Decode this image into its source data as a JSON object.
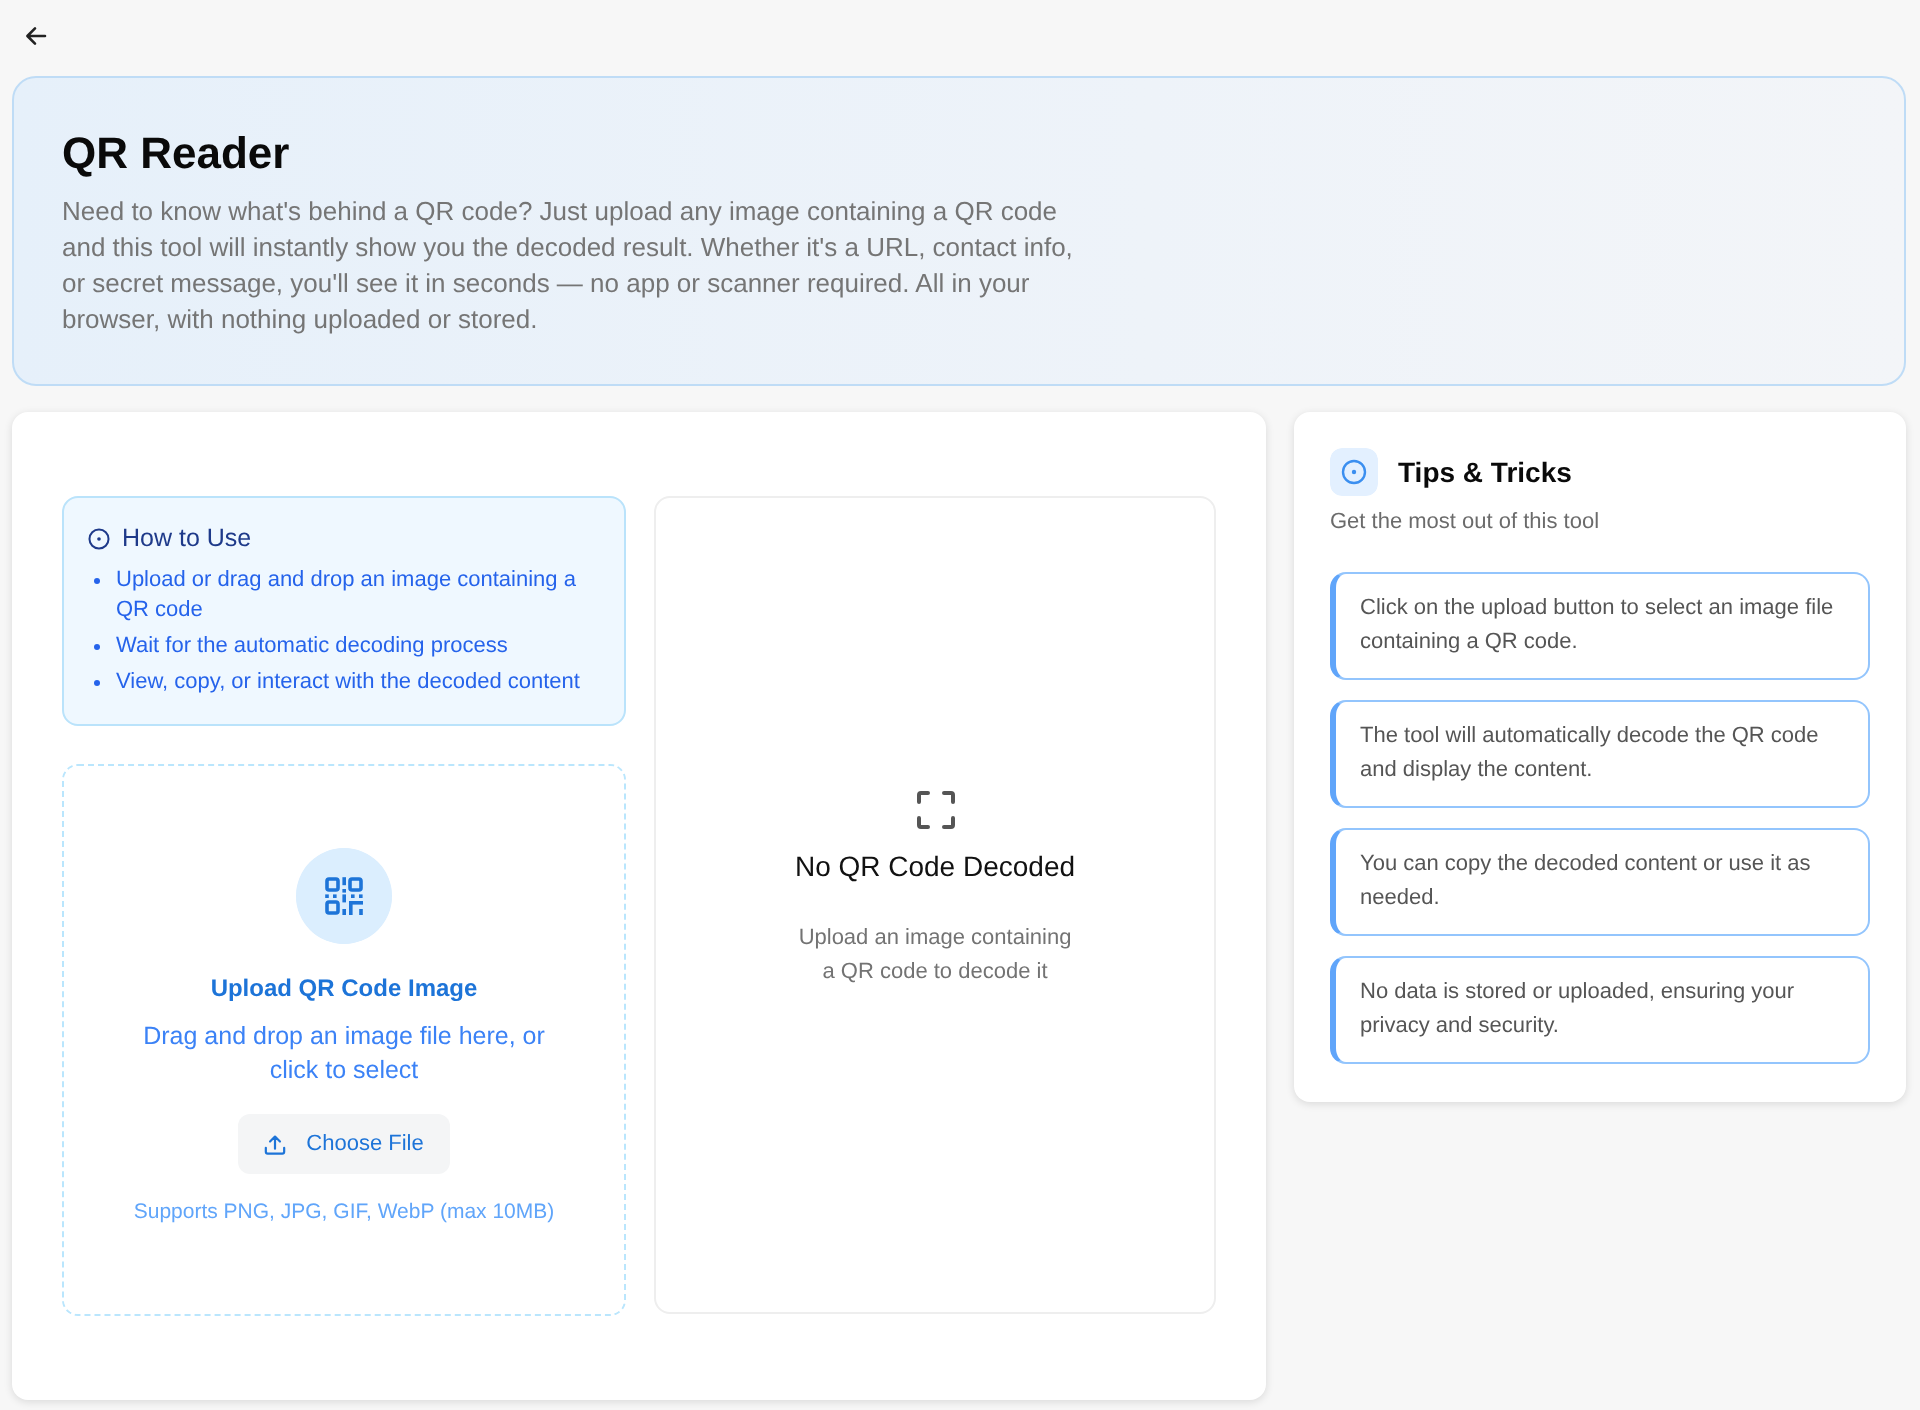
{
  "header": {
    "title": "QR Reader",
    "description": "Need to know what's behind a QR code? Just upload any image containing a QR code and this tool will instantly show you the decoded result. Whether it's a URL, contact info, or secret message, you'll see it in seconds — no app or scanner required. All in your browser, with nothing uploaded or stored."
  },
  "how_to_use": {
    "title": "How to Use",
    "steps": [
      "Upload or drag and drop an image containing a QR code",
      "Wait for the automatic decoding process",
      "View, copy, or interact with the decoded content"
    ]
  },
  "upload": {
    "title": "Upload QR Code Image",
    "description": "Drag and drop an image file here, or click to select",
    "button": "Choose File",
    "note": "Supports PNG, JPG, GIF, WebP (max 10MB)"
  },
  "result": {
    "title": "No QR Code Decoded",
    "description": "Upload an image containing a QR code to decode it"
  },
  "tips": {
    "title": "Tips & Tricks",
    "subtitle": "Get the most out of this tool",
    "items": [
      "Click on the upload button to select an image file containing a QR code.",
      "The tool will automatically decode the QR code and display the content.",
      "You can copy the decoded content or use it as needed.",
      "No data is stored or uploaded, ensuring your privacy and security."
    ]
  }
}
